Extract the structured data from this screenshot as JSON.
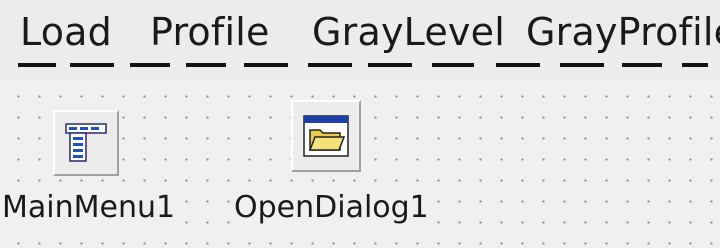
{
  "menu_bar": {
    "items": [
      {
        "label": "Load"
      },
      {
        "label": "Profile"
      },
      {
        "label": "GrayLevel"
      },
      {
        "label": "GrayProfile"
      }
    ]
  },
  "components": [
    {
      "name": "MainMenu1",
      "icon": "main-menu-icon"
    },
    {
      "name": "OpenDialog1",
      "icon": "open-dialog-folder-icon"
    }
  ],
  "colors": {
    "form_background": "#f0f0f0",
    "grid_dot": "#8a8a8a",
    "folder_fill": "#f5e17a",
    "dialog_titlebar": "#1c3fa8"
  }
}
